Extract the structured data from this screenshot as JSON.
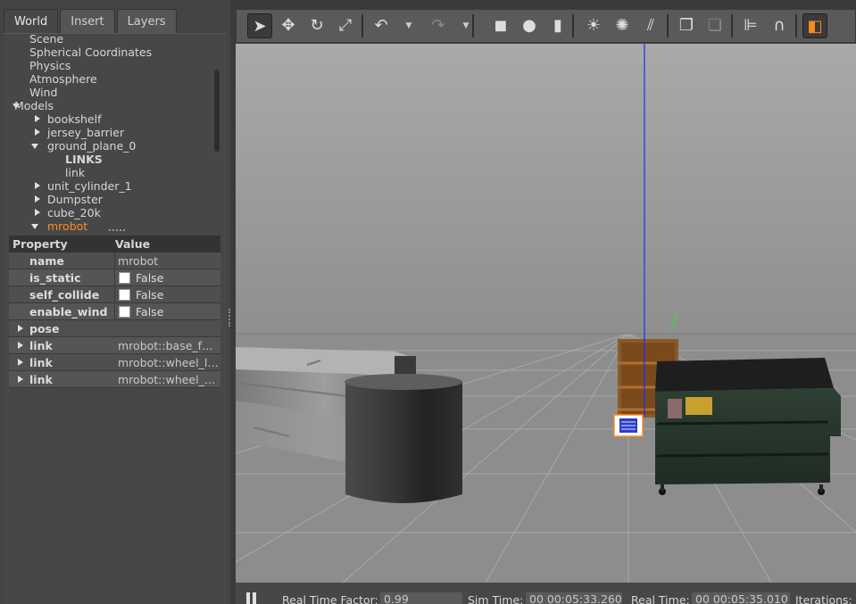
{
  "tabs": [
    "World",
    "Insert",
    "Layers"
  ],
  "tree": [
    {
      "label": "Scene",
      "level": 1,
      "toggle": "none"
    },
    {
      "label": "Spherical Coordinates",
      "level": 1,
      "toggle": "none"
    },
    {
      "label": "Physics",
      "level": 1,
      "toggle": "none"
    },
    {
      "label": "Atmosphere",
      "level": 1,
      "toggle": "none"
    },
    {
      "label": "Wind",
      "level": 1,
      "toggle": "none"
    },
    {
      "label": "Models",
      "level": 0,
      "toggle": "open"
    },
    {
      "label": "bookshelf",
      "level": 2,
      "toggle": "closed"
    },
    {
      "label": "jersey_barrier",
      "level": 2,
      "toggle": "closed"
    },
    {
      "label": "ground_plane_0",
      "level": 2,
      "toggle": "open"
    },
    {
      "label": "LINKS",
      "level": 3,
      "toggle": "none",
      "bold": true
    },
    {
      "label": "link",
      "level": 3,
      "toggle": "none"
    },
    {
      "label": "unit_cylinder_1",
      "level": 2,
      "toggle": "closed"
    },
    {
      "label": "Dumpster",
      "level": 2,
      "toggle": "closed"
    },
    {
      "label": "cube_20k",
      "level": 2,
      "toggle": "closed"
    },
    {
      "label": "mrobot",
      "level": 2,
      "toggle": "open",
      "selected": true
    }
  ],
  "properties": {
    "header_property": "Property",
    "header_value": "Value",
    "rows": [
      {
        "key": "name",
        "value": "mrobot",
        "type": "text",
        "expandable": false
      },
      {
        "key": "is_static",
        "value": "False",
        "type": "checkbox",
        "expandable": false
      },
      {
        "key": "self_collide",
        "value": "False",
        "type": "checkbox",
        "expandable": false
      },
      {
        "key": "enable_wind",
        "value": "False",
        "type": "checkbox",
        "expandable": false
      },
      {
        "key": "pose",
        "value": "",
        "type": "text",
        "expandable": true
      },
      {
        "key": "link",
        "value": "mrobot::base_footprint",
        "type": "text",
        "expandable": true
      },
      {
        "key": "link",
        "value": "mrobot::wheel_left_link",
        "type": "text",
        "expandable": true
      },
      {
        "key": "link",
        "value": "mrobot::wheel_right_link",
        "type": "text",
        "expandable": true
      }
    ]
  },
  "toolbar": [
    {
      "name": "select-mode-icon",
      "glyph": "➤",
      "active": true
    },
    {
      "name": "translate-mode-icon",
      "glyph": "✥"
    },
    {
      "name": "rotate-mode-icon",
      "glyph": "↻"
    },
    {
      "name": "scale-mode-icon",
      "glyph": "⤢"
    },
    {
      "name": "undo-icon",
      "glyph": "↶"
    },
    {
      "name": "redo-icon",
      "glyph": "↷",
      "dim": true
    },
    {
      "name": "box-shape-icon",
      "glyph": "◼"
    },
    {
      "name": "sphere-shape-icon",
      "glyph": "●"
    },
    {
      "name": "cylinder-shape-icon",
      "glyph": "▮"
    },
    {
      "name": "point-light-icon",
      "glyph": "☀"
    },
    {
      "name": "spot-light-icon",
      "glyph": "✺"
    },
    {
      "name": "directional-light-icon",
      "glyph": "⫽"
    },
    {
      "name": "copy-icon",
      "glyph": "❐"
    },
    {
      "name": "paste-icon",
      "glyph": "❏",
      "dim": true
    },
    {
      "name": "align-icon",
      "glyph": "⊫"
    },
    {
      "name": "snap-icon",
      "glyph": "∩"
    },
    {
      "name": "view-angle-icon",
      "glyph": "◧",
      "active": true
    }
  ],
  "status": {
    "rtf_label": "Real Time Factor:",
    "rtf_value": "0.99",
    "sim_label": "Sim Time:",
    "sim_value": "00 00:05:33.260",
    "real_label": "Real Time:",
    "real_value": "00 00:05:35.010",
    "iter_label": "Iterations:"
  },
  "colors": {
    "selection": "#ff8a1d",
    "z_axis": "#1f2bff",
    "y_axis": "#33dd33"
  }
}
